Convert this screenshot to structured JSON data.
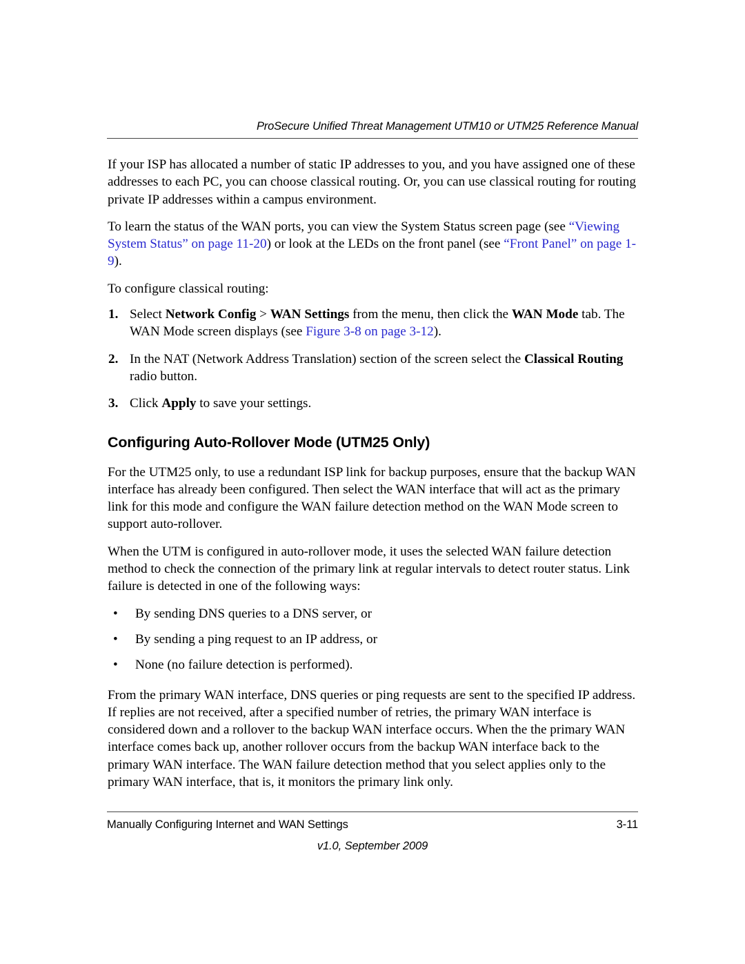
{
  "header": {
    "title": "ProSecure Unified Threat Management UTM10 or UTM25 Reference Manual"
  },
  "colors": {
    "link": "#2a2ad0",
    "text": "#000000",
    "rule": "#444444",
    "background": "#ffffff"
  },
  "body": {
    "paragraph_1": "If your ISP has allocated a number of static IP addresses to you, and you have assigned one of these addresses to each PC, you can choose classical routing. Or, you can use classical routing for routing private IP addresses within a campus environment.",
    "paragraph_2": {
      "part_1": "To learn the status of the WAN ports, you can view the System Status screen page (see ",
      "link_1": "“Viewing System Status” on page 11-20",
      "part_2": ") or look at the LEDs on the front panel (see ",
      "link_2": "“Front Panel” on page 1-9",
      "part_3": ")."
    },
    "lead_in": "To configure classical routing:",
    "steps": [
      {
        "number": "1.",
        "part_1": "Select ",
        "bold_1": "Network Config",
        "part_2": " > ",
        "bold_2": "WAN Settings",
        "part_3": " from the menu, then click the ",
        "bold_3": "WAN Mode",
        "part_4": " tab. The WAN Mode screen displays (see ",
        "link": "Figure 3-8 on page 3-12",
        "part_5": ")."
      },
      {
        "number": "2.",
        "part_1": "In the NAT (Network Address Translation) section of the screen select the ",
        "bold_1": "Classical Routing",
        "part_2": " radio button."
      },
      {
        "number": "3.",
        "part_1": "Click ",
        "bold_1": "Apply",
        "part_2": " to save your settings."
      }
    ],
    "section_heading": "Configuring Auto-Rollover Mode (UTM25 Only)",
    "paragraph_3": "For the UTM25 only, to use a redundant ISP link for backup purposes, ensure that the backup WAN interface has already been configured. Then select the WAN interface that will act as the primary link for this mode and configure the WAN failure detection method on the WAN Mode screen to support auto-rollover.",
    "paragraph_4": "When the UTM is configured in auto-rollover mode, it uses the selected WAN failure detection method to check the connection of the primary link at regular intervals to detect router status. Link failure is detected in one of the following ways:",
    "bullets": [
      "By sending DNS queries to a DNS server, or",
      "By sending a ping request to an IP address, or",
      "None (no failure detection is performed)."
    ],
    "bullet_glyph": "•",
    "paragraph_5": "From the primary WAN interface, DNS queries or ping requests are sent to the specified IP address. If replies are not received, after a specified number of retries, the primary WAN interface is considered down and a rollover to the backup WAN interface occurs. When the the primary WAN interface comes back up, another rollover occurs from the backup WAN interface back to the primary WAN interface. The WAN failure detection method that you select applies only to the primary WAN interface, that is, it monitors the primary link only."
  },
  "footer": {
    "chapter_title": "Manually Configuring Internet and WAN Settings",
    "page_number": "3-11",
    "version": "v1.0, September 2009"
  }
}
